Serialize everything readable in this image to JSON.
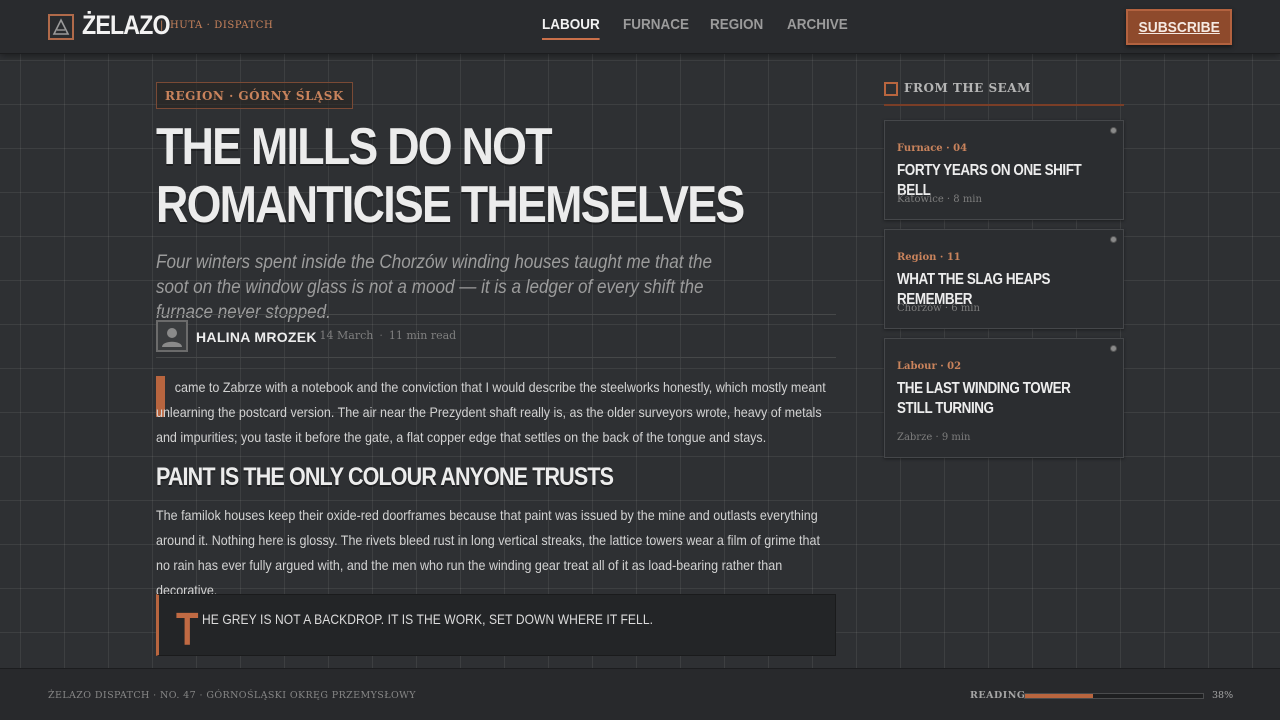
{
  "brand": {
    "name": "ŻELAZO",
    "tagline": "HUTA · DISPATCH",
    "logo_icon": "anvil-triangle-icon",
    "accent": "#b8653f"
  },
  "nav": {
    "items": [
      {
        "label": "LABOUR",
        "active": true
      },
      {
        "label": "FURNACE",
        "active": false
      },
      {
        "label": "REGION",
        "active": false
      },
      {
        "label": "ARCHIVE",
        "active": false
      }
    ],
    "subscribe_label": "SUBSCRIBE"
  },
  "article": {
    "kicker": "REGION · GÓRNY ŚLĄSK",
    "headline": "THE MILLS DO NOT ROMANTICISE THEMSELVES",
    "dek": "Four winters spent inside the Chorzów winding houses taught me that the soot on the window glass is not a mood — it is a ledger of every shift the furnace never stopped.",
    "author": "HALINA MROZEK",
    "date": "14 March",
    "read_time": "11 min read",
    "paragraph1": "came to Zabrze with a notebook and the conviction that I would describe the steelworks honestly, which mostly meant unlearning the postcard version. The air near the Prezydent shaft really is, as the older surveyors wrote, heavy of metals and impurities; you taste it before the gate, a flat copper edge that settles on the back of the tongue and stays.",
    "subhead": "PAINT IS THE ONLY COLOUR ANYONE TRUSTS",
    "paragraph2": "The familok houses keep their oxide-red doorframes because that paint was issued by the mine and outlasts everything around it. Nothing here is glossy. The rivets bleed rust in long vertical streaks, the lattice towers wear a film of grime that no rain has ever fully argued with, and the men who run the winding gear treat all of it as load-bearing rather than decorative.",
    "pullquote_cap": "T",
    "pullquote": "HE GREY IS NOT A BACKDROP. IT IS THE WORK, SET DOWN WHERE IT FELL."
  },
  "sidebar": {
    "title": "FROM THE SEAM",
    "cards": [
      {
        "category": "Furnace · 04",
        "title": "FORTY YEARS ON ONE SHIFT BELL",
        "meta": "Katowice · 8 min"
      },
      {
        "category": "Region · 11",
        "title": "WHAT THE SLAG HEAPS REMEMBER",
        "meta": "Chorzów · 6 min"
      },
      {
        "category": "Labour · 02",
        "title": "THE LAST WINDING TOWER STILL TURNING",
        "meta": "Zabrze · 9 min"
      }
    ]
  },
  "footer": {
    "left": "ŻELAZO DISPATCH · NO. 47 · GÓRNOŚLĄSKI OKRĘG PRZEMYSŁOWY",
    "reading_label": "READING",
    "reading_percent": "38%",
    "reading_progress": 0.38
  }
}
